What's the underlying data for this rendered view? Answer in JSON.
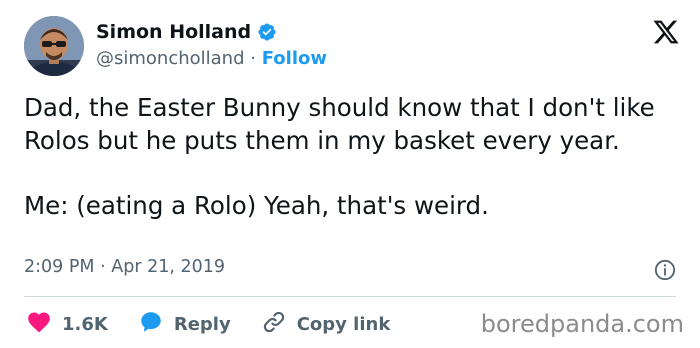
{
  "author": {
    "name": "Simon Holland",
    "handle": "@simoncholland",
    "separator": "·",
    "follow_label": "Follow"
  },
  "tweet": {
    "text": "Dad, the Easter Bunny should know that I don't like Rolos but he puts them in my basket every year.\n\nMe: (eating a Rolo) Yeah, that's weird.",
    "time": "2:09 PM",
    "date": "Apr 21, 2019"
  },
  "actions": {
    "likes": "1.6K",
    "reply_label": "Reply",
    "copy_link_label": "Copy link"
  },
  "watermark": "boredpanda.com",
  "icons": {
    "verified": "verified-badge-icon",
    "x_logo": "x-logo-icon",
    "info": "info-icon",
    "like": "heart-icon",
    "reply": "speech-bubble-icon",
    "link": "link-icon"
  },
  "colors": {
    "accent": "#1d9bf0",
    "like": "#f91880",
    "text_primary": "#0f1419",
    "text_secondary": "#536471"
  }
}
